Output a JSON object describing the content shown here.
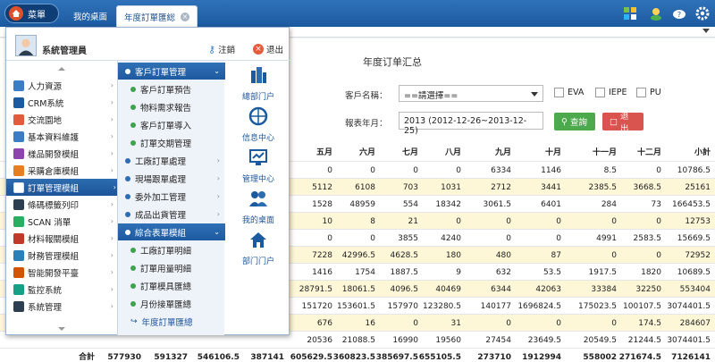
{
  "topbar": {
    "menu_label": "菜單",
    "tabs": [
      {
        "label": "我的桌面"
      },
      {
        "label": "年度訂單匯総"
      }
    ],
    "tab_close": "×"
  },
  "menu_panel": {
    "admin_name": "系統管理員",
    "logout_label": "注銷",
    "quit_label": "退出",
    "main_items": [
      {
        "label": "人力資源",
        "icon": "people-icon"
      },
      {
        "label": "CRM系統",
        "icon": "crm-icon"
      },
      {
        "label": "交流園地",
        "icon": "chat-icon"
      },
      {
        "label": "基本資料維護",
        "icon": "database-icon"
      },
      {
        "label": "樣品開發模組",
        "icon": "sample-icon"
      },
      {
        "label": "采購倉庫模組",
        "icon": "warehouse-icon"
      },
      {
        "label": "訂單管理模組",
        "icon": "order-icon"
      },
      {
        "label": "條碼標籤列印",
        "icon": "barcode-icon"
      },
      {
        "label": "SCAN 消單",
        "icon": "scan-icon"
      },
      {
        "label": "材料報關模組",
        "icon": "customs-icon"
      },
      {
        "label": "財務管理模組",
        "icon": "finance-icon"
      },
      {
        "label": "智能開發平臺",
        "icon": "platform-icon"
      },
      {
        "label": "監控系統",
        "icon": "monitor-icon"
      },
      {
        "label": "系統管理",
        "icon": "system-gear-icon"
      }
    ],
    "sub_groups": [
      {
        "label": "客戶訂單管理",
        "children": [
          "客戶訂單預告",
          "物料需求報告",
          "客戶訂單導入",
          "訂單交期管理"
        ]
      },
      {
        "label": "工廠訂單處理"
      },
      {
        "label": "現場跟單處理"
      },
      {
        "label": "委外加工管理"
      },
      {
        "label": "成品出貨管理"
      },
      {
        "label": "綜合表單模組",
        "children": [
          "工廠訂單明細",
          "訂單用量明細",
          "訂單模具匯總",
          "月份接單匯總",
          "年度訂單匯總"
        ]
      }
    ],
    "quick_links": [
      {
        "label": "總部门户",
        "icon": "building-icon"
      },
      {
        "label": "信息中心",
        "icon": "globe-icon"
      },
      {
        "label": "管理中心",
        "icon": "chart-monitor-icon"
      },
      {
        "label": "我的桌面",
        "icon": "desktop-users-icon"
      },
      {
        "label": "部门门户",
        "icon": "home-icon"
      }
    ]
  },
  "report": {
    "title": "年度订单汇总",
    "customer_label": "客戶名稱：",
    "customer_value": "==請選擇==",
    "checkboxes": [
      "EVA",
      "IEPE",
      "PU"
    ],
    "period_label": "報表年月：",
    "period_value": "2013 (2012-12-26~2013-12-25)",
    "query_label": "查詢",
    "exit_label": "退出"
  },
  "table": {
    "columns": [
      "五月",
      "六月",
      "七月",
      "八月",
      "九月",
      "十月",
      "十一月",
      "十二月",
      "小計"
    ],
    "rows": [
      [
        "0",
        "0",
        "0",
        "0",
        "6334",
        "1146",
        "8.5",
        "0",
        "10786.5"
      ],
      [
        "5112",
        "6108",
        "703",
        "1031",
        "2712",
        "3441",
        "2385.5",
        "3668.5",
        "25161"
      ],
      [
        "1528",
        "48959",
        "554",
        "18342",
        "3061.5",
        "6401",
        "284",
        "73",
        "166453.5"
      ],
      [
        "10",
        "8",
        "21",
        "0",
        "0",
        "0",
        "0",
        "0",
        "12753"
      ],
      [
        "0",
        "0",
        "3855",
        "4240",
        "0",
        "0",
        "4991",
        "2583.5",
        "15669.5"
      ],
      [
        "7228",
        "42996.5",
        "4628.5",
        "180",
        "480",
        "87",
        "0",
        "0",
        "72952"
      ],
      [
        "1416",
        "1754",
        "1887.5",
        "9",
        "632",
        "53.5",
        "1917.5",
        "1820",
        "10689.5"
      ],
      [
        "28791.5",
        "18061.5",
        "4096.5",
        "40469",
        "6344",
        "42063",
        "33384",
        "32250",
        "553404"
      ],
      [
        "151720",
        "153601.5",
        "157970",
        "123280.5",
        "140177",
        "1696824.5",
        "175023.5",
        "100107.5",
        "3074401.5"
      ],
      [
        "676",
        "16",
        "0",
        "31",
        "0",
        "0",
        "0",
        "174.5",
        "284607"
      ],
      [
        "20536",
        "21088.5",
        "16990",
        "19560",
        "27454",
        "23649.5",
        "20549.5",
        "21244.5",
        "3074401.5"
      ]
    ],
    "total_label": "合計",
    "total_first": "577930",
    "totals": [
      "591327",
      "546106.5",
      "387141",
      "605629.5",
      "360823.5",
      "385697.5",
      "655105.5",
      "273710",
      "1912994",
      "558002",
      "271674.5",
      "7126141"
    ]
  }
}
